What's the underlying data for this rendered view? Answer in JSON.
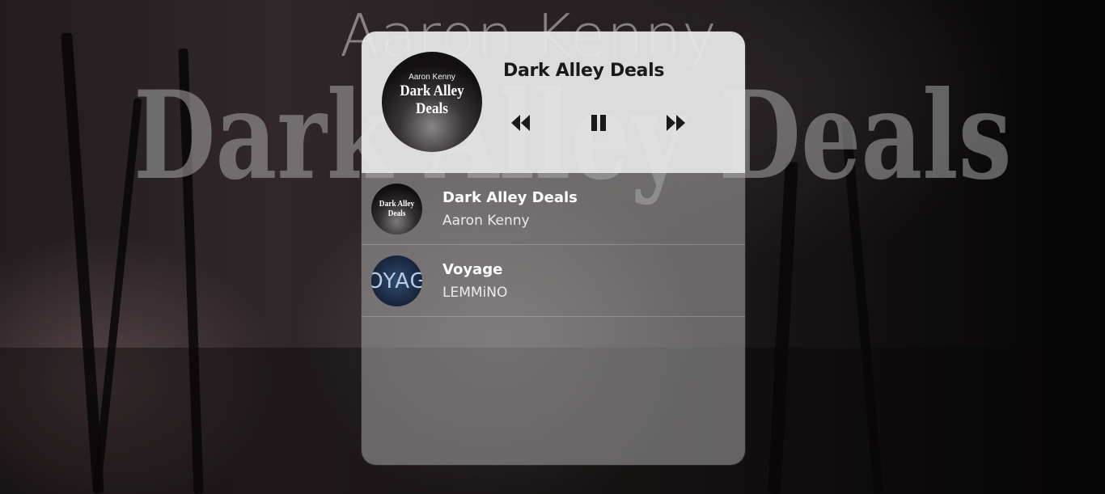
{
  "background": {
    "artist_text": "Aaron Kenny",
    "title_text": "Dark Alley Deals"
  },
  "now_playing": {
    "cover_artist": "Aaron Kenny",
    "cover_title": "Dark Alley Deals",
    "title": "Dark Alley Deals",
    "state": "playing"
  },
  "controls": {
    "previous_icon": "rewind-icon",
    "pause_icon": "pause-icon",
    "next_icon": "fast-forward-icon"
  },
  "playlist": [
    {
      "title": "Dark Alley Deals",
      "artist": "Aaron Kenny",
      "thumb_text": "Dark Alley Deals"
    },
    {
      "title": "Voyage",
      "artist": "LEMMiNO",
      "thumb_text": "OYAG"
    }
  ],
  "colors": {
    "card_header": "#ececec",
    "text_dark": "#1a1a1a",
    "text_light": "#ffffff"
  }
}
